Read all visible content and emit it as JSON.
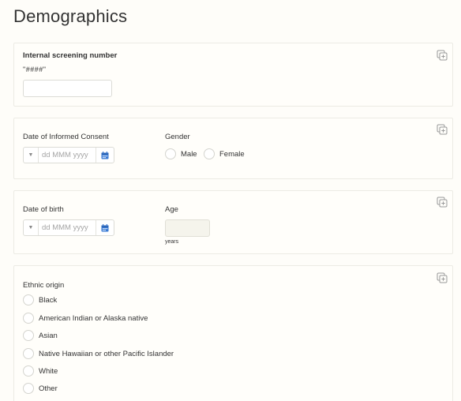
{
  "page": {
    "title": "Demographics"
  },
  "screening": {
    "label": "Internal screening number",
    "hint": "\"####\"",
    "value": ""
  },
  "consent": {
    "label": "Date of Informed Consent",
    "placeholder": "dd MMM yyyy"
  },
  "gender": {
    "label": "Gender",
    "options": [
      "Male",
      "Female"
    ]
  },
  "dob": {
    "label": "Date of birth",
    "placeholder": "dd MMM yyyy"
  },
  "age": {
    "label": "Age",
    "unit": "years"
  },
  "ethnic": {
    "label": "Ethnic origin",
    "options": [
      "Black",
      "American Indian or Alaska native",
      "Asian",
      "Native Hawaiian or other Pacific Islander",
      "White",
      "Other"
    ]
  },
  "colors": {
    "accent": "#3a7bd5",
    "border": "#ecebe4",
    "background": "#fefdf9"
  },
  "icons": {
    "copy": "copy-add-icon",
    "calendar": "calendar-icon",
    "caret": "caret-down-icon"
  }
}
